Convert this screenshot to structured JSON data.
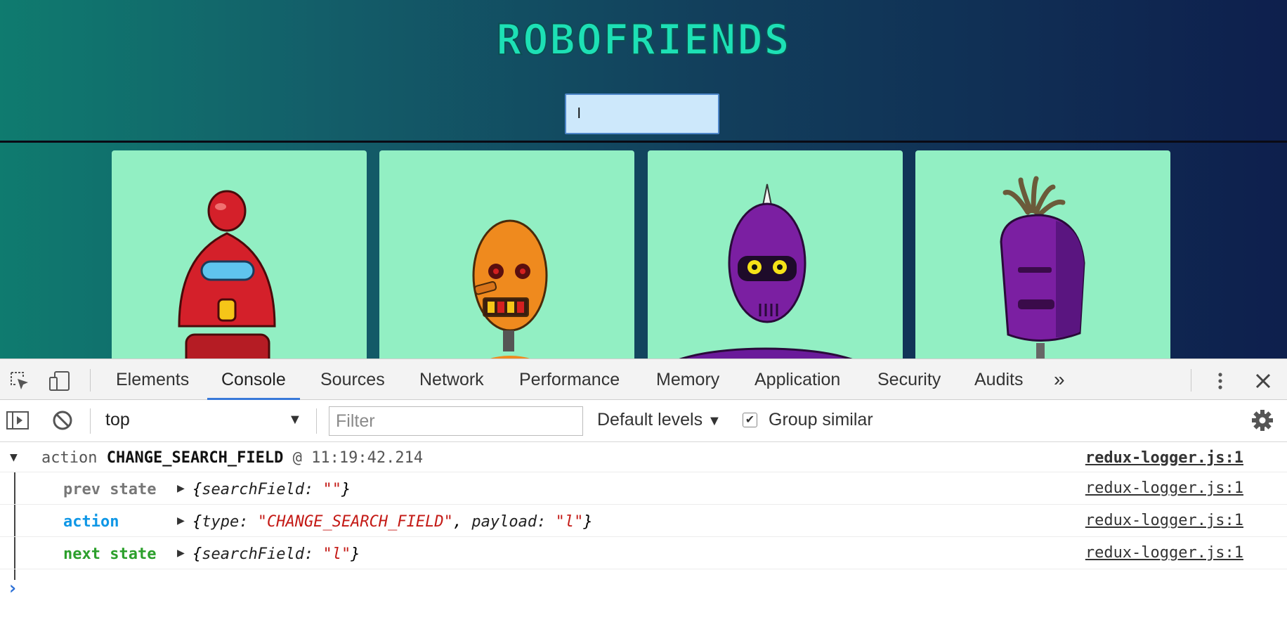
{
  "app": {
    "logo_text": "ROBOFRIENDS",
    "search_value": "l",
    "accent_color": "#1de0b5",
    "card_color": "#92efc3",
    "robots": [
      "red-robot",
      "orange-robot",
      "purple-spiked-robot",
      "purple-tufted-robot"
    ]
  },
  "devtools": {
    "tabs": [
      "Elements",
      "Console",
      "Sources",
      "Network",
      "Performance",
      "Memory",
      "Application",
      "Security",
      "Audits"
    ],
    "active_tab": "Console",
    "more_tabs": "»",
    "context": "top",
    "filter_placeholder": "Filter",
    "levels_label": "Default levels",
    "group_similar_label": "Group similar",
    "group_similar_checked": true
  },
  "console": {
    "group": {
      "prefix": "action",
      "type": "CHANGE_SEARCH_FIELD",
      "at": "@ 11:19:42.214",
      "source": "redux-logger.js:1"
    },
    "entries": [
      {
        "label": "prev state",
        "color": "#777777",
        "open": "{",
        "parts": [
          {
            "key": "searchField:",
            "value": "\"\""
          }
        ],
        "close": "}",
        "source": "redux-logger.js:1"
      },
      {
        "label": "action",
        "color": "#0f97e6",
        "open": "{",
        "parts": [
          {
            "key": "type:",
            "value": "\"CHANGE_SEARCH_FIELD\""
          },
          {
            "key": "payload:",
            "value": "\"l\""
          }
        ],
        "close": "}",
        "source": "redux-logger.js:1"
      },
      {
        "label": "next state",
        "color": "#2ca02c",
        "open": "{",
        "parts": [
          {
            "key": "searchField:",
            "value": "\"l\""
          }
        ],
        "close": "}",
        "source": "redux-logger.js:1"
      }
    ],
    "prompt": "›"
  }
}
